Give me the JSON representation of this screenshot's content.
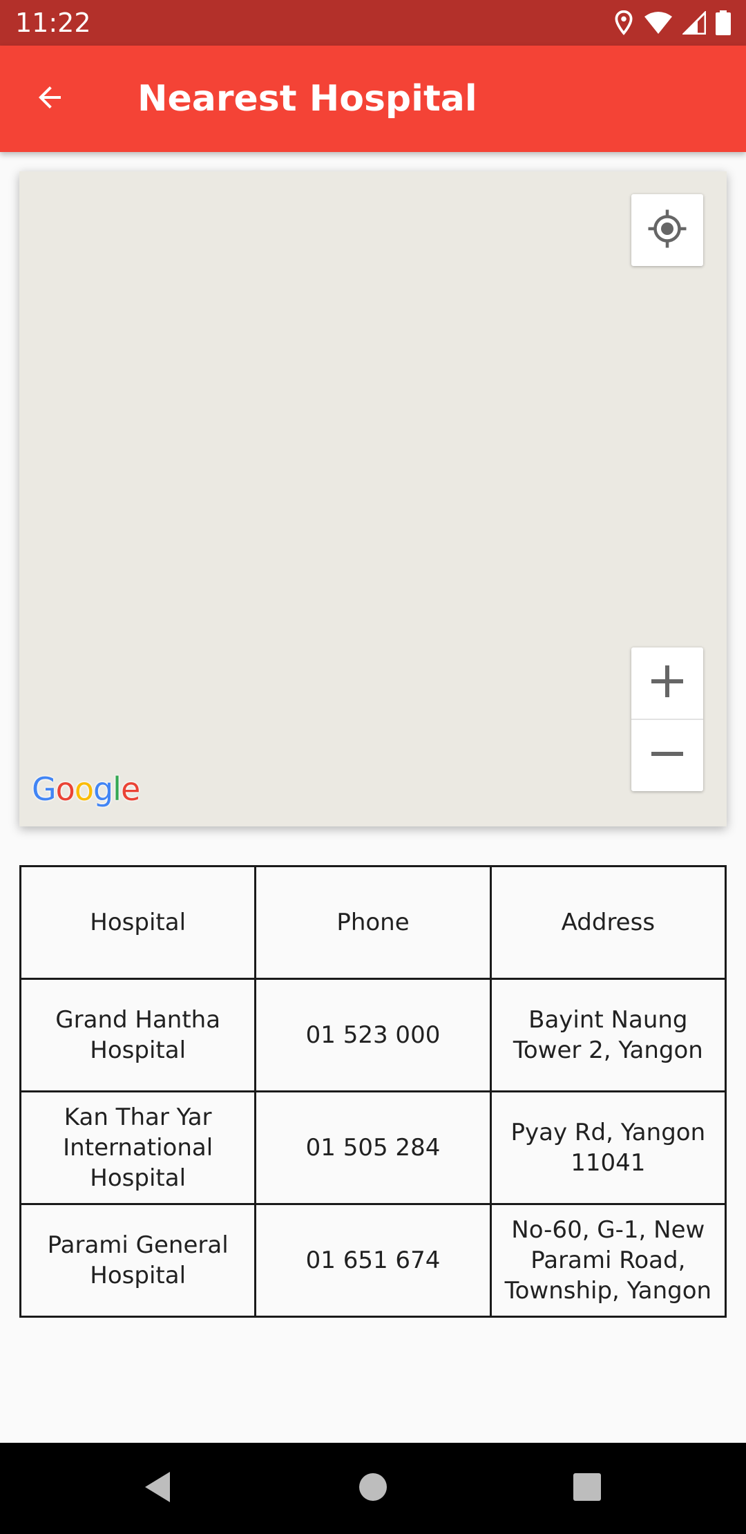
{
  "status_bar": {
    "time": "11:22",
    "icons": [
      "location-icon",
      "wifi-icon",
      "signal-icon",
      "battery-icon"
    ]
  },
  "app_bar": {
    "title": "Nearest Hospital",
    "back_icon": "arrow-back-icon",
    "background_color": "#f44336"
  },
  "map": {
    "attribution": "Google",
    "controls": [
      "my-location-icon",
      "zoom-in-icon",
      "zoom-out-icon"
    ],
    "background_color": "#ebe9e2"
  },
  "table": {
    "headers": [
      "Hospital",
      "Phone",
      "Address"
    ],
    "rows": [
      [
        "Grand Hantha Hospital",
        "01 523 000",
        "Bayint Naung Tower 2, Yangon"
      ],
      [
        "Kan Thar Yar International Hospital",
        "01 505 284",
        "Pyay Rd, Yangon 11041"
      ],
      [
        "Parami General Hospital",
        "01 651 674",
        "No-60, G-1, New Parami Road, Township, Yangon"
      ]
    ]
  },
  "nav_bar": {
    "icons": [
      "back-triangle-icon",
      "home-circle-icon",
      "recents-square-icon"
    ]
  }
}
